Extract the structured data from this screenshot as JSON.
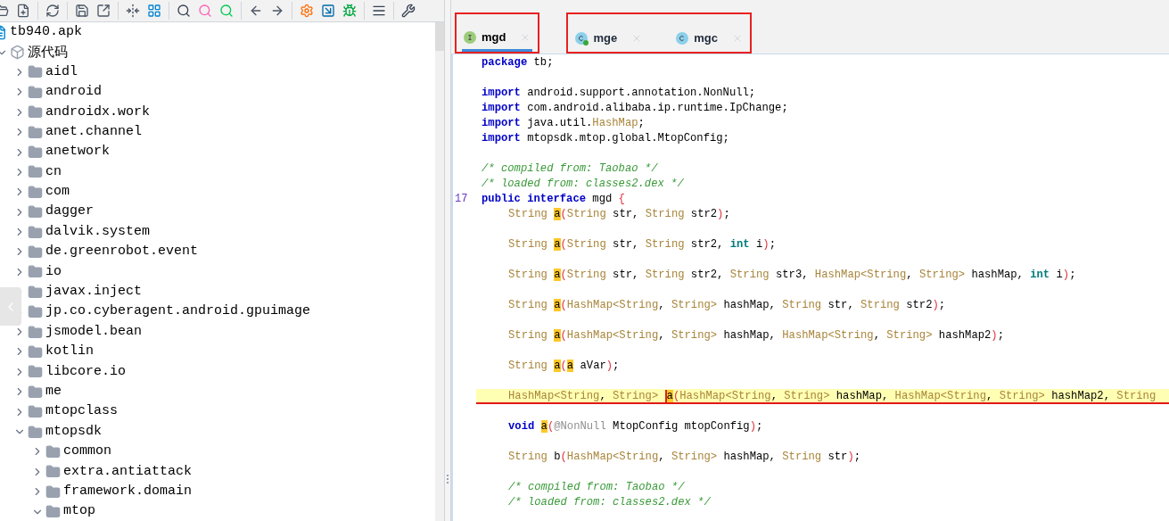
{
  "tree": [
    {
      "label": "tb940.apk",
      "kind": "file",
      "children": [
        {
          "label": "源代码",
          "kind": "package",
          "expanded": true,
          "children": [
            {
              "label": "aidl",
              "kind": "folder",
              "expanded": false
            },
            {
              "label": "android",
              "kind": "folder",
              "expanded": false
            },
            {
              "label": "androidx.work",
              "kind": "folder",
              "expanded": false
            },
            {
              "label": "anet.channel",
              "kind": "folder",
              "expanded": false
            },
            {
              "label": "anetwork",
              "kind": "folder",
              "expanded": false
            },
            {
              "label": "cn",
              "kind": "folder",
              "expanded": false
            },
            {
              "label": "com",
              "kind": "folder",
              "expanded": false
            },
            {
              "label": "dagger",
              "kind": "folder",
              "expanded": false
            },
            {
              "label": "dalvik.system",
              "kind": "folder",
              "expanded": false
            },
            {
              "label": "de.greenrobot.event",
              "kind": "folder",
              "expanded": false
            },
            {
              "label": "io",
              "kind": "folder",
              "expanded": false
            },
            {
              "label": "javax.inject",
              "kind": "folder",
              "expanded": false
            },
            {
              "label": "jp.co.cyberagent.android.gpuimage",
              "kind": "folder",
              "expanded": false
            },
            {
              "label": "jsmodel.bean",
              "kind": "folder",
              "expanded": false
            },
            {
              "label": "kotlin",
              "kind": "folder",
              "expanded": false
            },
            {
              "label": "libcore.io",
              "kind": "folder",
              "expanded": false
            },
            {
              "label": "me",
              "kind": "folder",
              "expanded": false
            },
            {
              "label": "mtopclass",
              "kind": "folder",
              "expanded": false
            },
            {
              "label": "mtopsdk",
              "kind": "folder",
              "expanded": true,
              "children": [
                {
                  "label": "common",
                  "kind": "folder",
                  "expanded": false
                },
                {
                  "label": "extra.antiattack",
                  "kind": "folder",
                  "expanded": false
                },
                {
                  "label": "framework.domain",
                  "kind": "folder",
                  "expanded": false
                },
                {
                  "label": "mtop",
                  "kind": "folder",
                  "expanded": true
                }
              ]
            }
          ]
        }
      ]
    }
  ],
  "tab_groups": [
    {
      "outlined": true,
      "tabs": [
        {
          "label": "mgd",
          "kind": "interface",
          "selected": true
        }
      ]
    },
    {
      "outlined": true,
      "tabs": [
        {
          "label": "mge",
          "kind": "class-run",
          "selected": false
        },
        {
          "label": "mgc",
          "kind": "class",
          "selected": false
        }
      ]
    }
  ],
  "code": [
    {
      "current": false,
      "indented": false,
      "tokens": [
        {
          "t": "package ",
          "kind": "kw"
        },
        {
          "t": "tb;",
          "kind": "plain"
        }
      ]
    },
    {
      "current": false
    },
    {
      "current": false,
      "indented": false,
      "tokens": [
        {
          "t": "import ",
          "kind": "kw"
        },
        {
          "t": "android.support.annotation.NonNull;",
          "kind": "plain"
        }
      ]
    },
    {
      "current": false,
      "indented": false,
      "tokens": [
        {
          "t": "import ",
          "kind": "kw"
        },
        {
          "t": "com.android.alibaba.ip.runtime.IpChange;",
          "kind": "plain"
        }
      ]
    },
    {
      "current": false,
      "indented": false,
      "tokens": [
        {
          "t": "import ",
          "kind": "kw"
        },
        {
          "t": "java.util.",
          "kind": "plain"
        },
        {
          "t": "HashMap",
          "kind": "type"
        },
        {
          "t": ";",
          "kind": "plain"
        }
      ]
    },
    {
      "current": false,
      "indented": false,
      "tokens": [
        {
          "t": "import ",
          "kind": "kw"
        },
        {
          "t": "mtopsdk.mtop.global.MtopConfig;",
          "kind": "plain"
        }
      ]
    },
    {
      "current": false
    },
    {
      "current": false,
      "indented": false,
      "tokens": [
        {
          "t": "/* compiled from: Taobao */",
          "kind": "comment"
        }
      ]
    },
    {
      "current": false,
      "indented": false,
      "tokens": [
        {
          "t": "/* loaded from: classes2.dex */",
          "kind": "comment"
        }
      ]
    },
    {
      "current": false,
      "indented": false,
      "number": "17",
      "tokens": [
        {
          "t": "public interface ",
          "kind": "kw"
        },
        {
          "t": "mgd ",
          "kind": "plain"
        },
        {
          "t": "{",
          "kind": "paren"
        }
      ]
    },
    {
      "current": false,
      "indented": true,
      "tokens": [
        {
          "t": "String ",
          "kind": "type"
        },
        {
          "t": "a",
          "kind": "mark"
        },
        {
          "t": "(",
          "kind": "paren"
        },
        {
          "t": "String ",
          "kind": "type"
        },
        {
          "t": "str, ",
          "kind": "plain"
        },
        {
          "t": "String ",
          "kind": "type"
        },
        {
          "t": "str2",
          "kind": "plain"
        },
        {
          "t": ")",
          "kind": "paren"
        },
        {
          "t": ";",
          "kind": "plain"
        }
      ]
    },
    {
      "current": false
    },
    {
      "current": false,
      "indented": true,
      "tokens": [
        {
          "t": "String ",
          "kind": "type"
        },
        {
          "t": "a",
          "kind": "mark"
        },
        {
          "t": "(",
          "kind": "paren"
        },
        {
          "t": "String ",
          "kind": "type"
        },
        {
          "t": "str, ",
          "kind": "plain"
        },
        {
          "t": "String ",
          "kind": "type"
        },
        {
          "t": "str2, ",
          "kind": "plain"
        },
        {
          "t": "int ",
          "kind": "prim"
        },
        {
          "t": "i",
          "kind": "plain"
        },
        {
          "t": ")",
          "kind": "paren"
        },
        {
          "t": ";",
          "kind": "plain"
        }
      ]
    },
    {
      "current": false
    },
    {
      "current": false,
      "indented": true,
      "tokens": [
        {
          "t": "String ",
          "kind": "type"
        },
        {
          "t": "a",
          "kind": "mark"
        },
        {
          "t": "(",
          "kind": "paren"
        },
        {
          "t": "String ",
          "kind": "type"
        },
        {
          "t": "str, ",
          "kind": "plain"
        },
        {
          "t": "String ",
          "kind": "type"
        },
        {
          "t": "str2, ",
          "kind": "plain"
        },
        {
          "t": "String ",
          "kind": "type"
        },
        {
          "t": "str3, ",
          "kind": "plain"
        },
        {
          "t": "HashMap<String",
          "kind": "type"
        },
        {
          "t": ", ",
          "kind": "plain"
        },
        {
          "t": "String> ",
          "kind": "type"
        },
        {
          "t": "hashMap, ",
          "kind": "plain"
        },
        {
          "t": "int ",
          "kind": "prim"
        },
        {
          "t": "i",
          "kind": "plain"
        },
        {
          "t": ")",
          "kind": "paren"
        },
        {
          "t": ";",
          "kind": "plain"
        }
      ]
    },
    {
      "current": false
    },
    {
      "current": false,
      "indented": true,
      "tokens": [
        {
          "t": "String ",
          "kind": "type"
        },
        {
          "t": "a",
          "kind": "mark"
        },
        {
          "t": "(",
          "kind": "paren"
        },
        {
          "t": "HashMap<String",
          "kind": "type"
        },
        {
          "t": ", ",
          "kind": "plain"
        },
        {
          "t": "String> ",
          "kind": "type"
        },
        {
          "t": "hashMap, ",
          "kind": "plain"
        },
        {
          "t": "String ",
          "kind": "type"
        },
        {
          "t": "str, ",
          "kind": "plain"
        },
        {
          "t": "String ",
          "kind": "type"
        },
        {
          "t": "str2",
          "kind": "plain"
        },
        {
          "t": ")",
          "kind": "paren"
        },
        {
          "t": ";",
          "kind": "plain"
        }
      ]
    },
    {
      "current": false
    },
    {
      "current": false,
      "indented": true,
      "tokens": [
        {
          "t": "String ",
          "kind": "type"
        },
        {
          "t": "a",
          "kind": "mark"
        },
        {
          "t": "(",
          "kind": "paren"
        },
        {
          "t": "HashMap<String",
          "kind": "type"
        },
        {
          "t": ", ",
          "kind": "plain"
        },
        {
          "t": "String> ",
          "kind": "type"
        },
        {
          "t": "hashMap, ",
          "kind": "plain"
        },
        {
          "t": "HashMap<String",
          "kind": "type"
        },
        {
          "t": ", ",
          "kind": "plain"
        },
        {
          "t": "String> ",
          "kind": "type"
        },
        {
          "t": "hashMap2",
          "kind": "plain"
        },
        {
          "t": ")",
          "kind": "paren"
        },
        {
          "t": ";",
          "kind": "plain"
        }
      ]
    },
    {
      "current": false
    },
    {
      "current": false,
      "indented": true,
      "tokens": [
        {
          "t": "String ",
          "kind": "type"
        },
        {
          "t": "a",
          "kind": "mark"
        },
        {
          "t": "(",
          "kind": "paren"
        },
        {
          "t": "a",
          "kind": "mark"
        },
        {
          "t": " aVar",
          "kind": "plain"
        },
        {
          "t": ")",
          "kind": "paren"
        },
        {
          "t": ";",
          "kind": "plain"
        }
      ]
    },
    {
      "current": false
    },
    {
      "current": true,
      "indented": true,
      "tokens": [
        {
          "t": "HashMap<String",
          "kind": "type"
        },
        {
          "t": ", ",
          "kind": "plain"
        },
        {
          "t": "String> ",
          "kind": "type"
        },
        {
          "t": "a",
          "kind": "caret"
        },
        {
          "t": "(",
          "kind": "paren"
        },
        {
          "t": "HashMap<String",
          "kind": "type"
        },
        {
          "t": ", ",
          "kind": "plain"
        },
        {
          "t": "String> ",
          "kind": "type"
        },
        {
          "t": "hashMap, ",
          "kind": "plain"
        },
        {
          "t": "HashMap<String",
          "kind": "type"
        },
        {
          "t": ", ",
          "kind": "plain"
        },
        {
          "t": "String> ",
          "kind": "type"
        },
        {
          "t": "hashMap2, ",
          "kind": "plain"
        },
        {
          "t": "String",
          "kind": "type"
        }
      ]
    },
    {
      "current": false
    },
    {
      "current": false,
      "indented": true,
      "tokens": [
        {
          "t": "void ",
          "kind": "kw"
        },
        {
          "t": "a",
          "kind": "mark"
        },
        {
          "t": "(",
          "kind": "paren"
        },
        {
          "t": "@NonNull ",
          "kind": "anno"
        },
        {
          "t": "MtopConfig mtopConfig",
          "kind": "plain"
        },
        {
          "t": ")",
          "kind": "paren"
        },
        {
          "t": ";",
          "kind": "plain"
        }
      ]
    },
    {
      "current": false
    },
    {
      "current": false,
      "indented": true,
      "tokens": [
        {
          "t": "String ",
          "kind": "type"
        },
        {
          "t": "b",
          "kind": "plain"
        },
        {
          "t": "(",
          "kind": "paren"
        },
        {
          "t": "HashMap<String",
          "kind": "type"
        },
        {
          "t": ", ",
          "kind": "plain"
        },
        {
          "t": "String> ",
          "kind": "type"
        },
        {
          "t": "hashMap, ",
          "kind": "plain"
        },
        {
          "t": "String ",
          "kind": "type"
        },
        {
          "t": "str",
          "kind": "plain"
        },
        {
          "t": ")",
          "kind": "paren"
        },
        {
          "t": ";",
          "kind": "plain"
        }
      ]
    },
    {
      "current": false
    },
    {
      "current": false,
      "indented": true,
      "tokens": [
        {
          "t": "/* compiled from: Taobao */",
          "kind": "comment"
        }
      ]
    },
    {
      "current": false,
      "indented": true,
      "tokens": [
        {
          "t": "/* loaded from: classes2.dex */",
          "kind": "comment"
        }
      ]
    }
  ]
}
